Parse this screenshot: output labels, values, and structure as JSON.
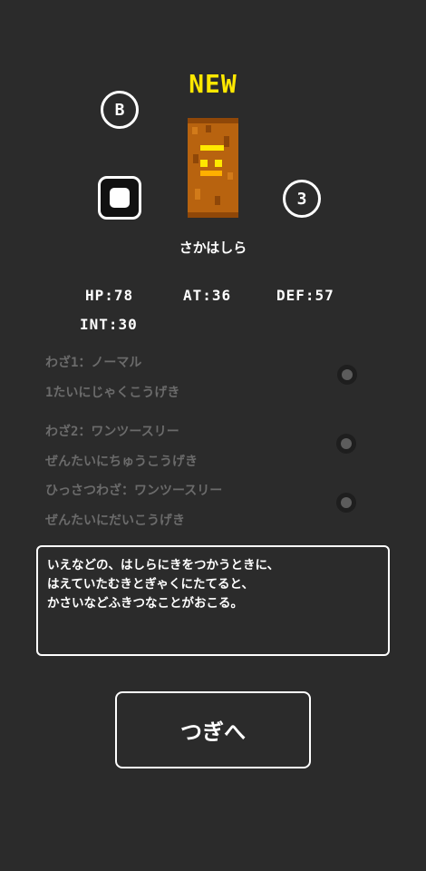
{
  "badge": "NEW",
  "rank": "B",
  "count": "3",
  "creature": {
    "name": "さかはしら"
  },
  "stats": {
    "hp": "HP:78",
    "at": "AT:36",
    "def": "DEF:57",
    "int": "INT:30"
  },
  "skills": [
    {
      "title": "わざ1：ノーマル",
      "desc": "1たいにじゃくこうげき"
    },
    {
      "title": "わざ2：ワンツースリー",
      "desc": "ぜんたいにちゅうこうげき"
    },
    {
      "title": "ひっさつわざ：ワンツースリー",
      "desc": "ぜんたいにだいこうげき"
    }
  ],
  "description": [
    "いえなどの、はしらにきをつかうときに、",
    "はえていたむきとぎゃくにたてると、",
    "かさいなどふきつなことがおこる。"
  ],
  "next_button": "つぎへ",
  "colors": {
    "background": "#2b2b2b",
    "accent": "#ffe800",
    "creature_body": "#b8630f"
  }
}
